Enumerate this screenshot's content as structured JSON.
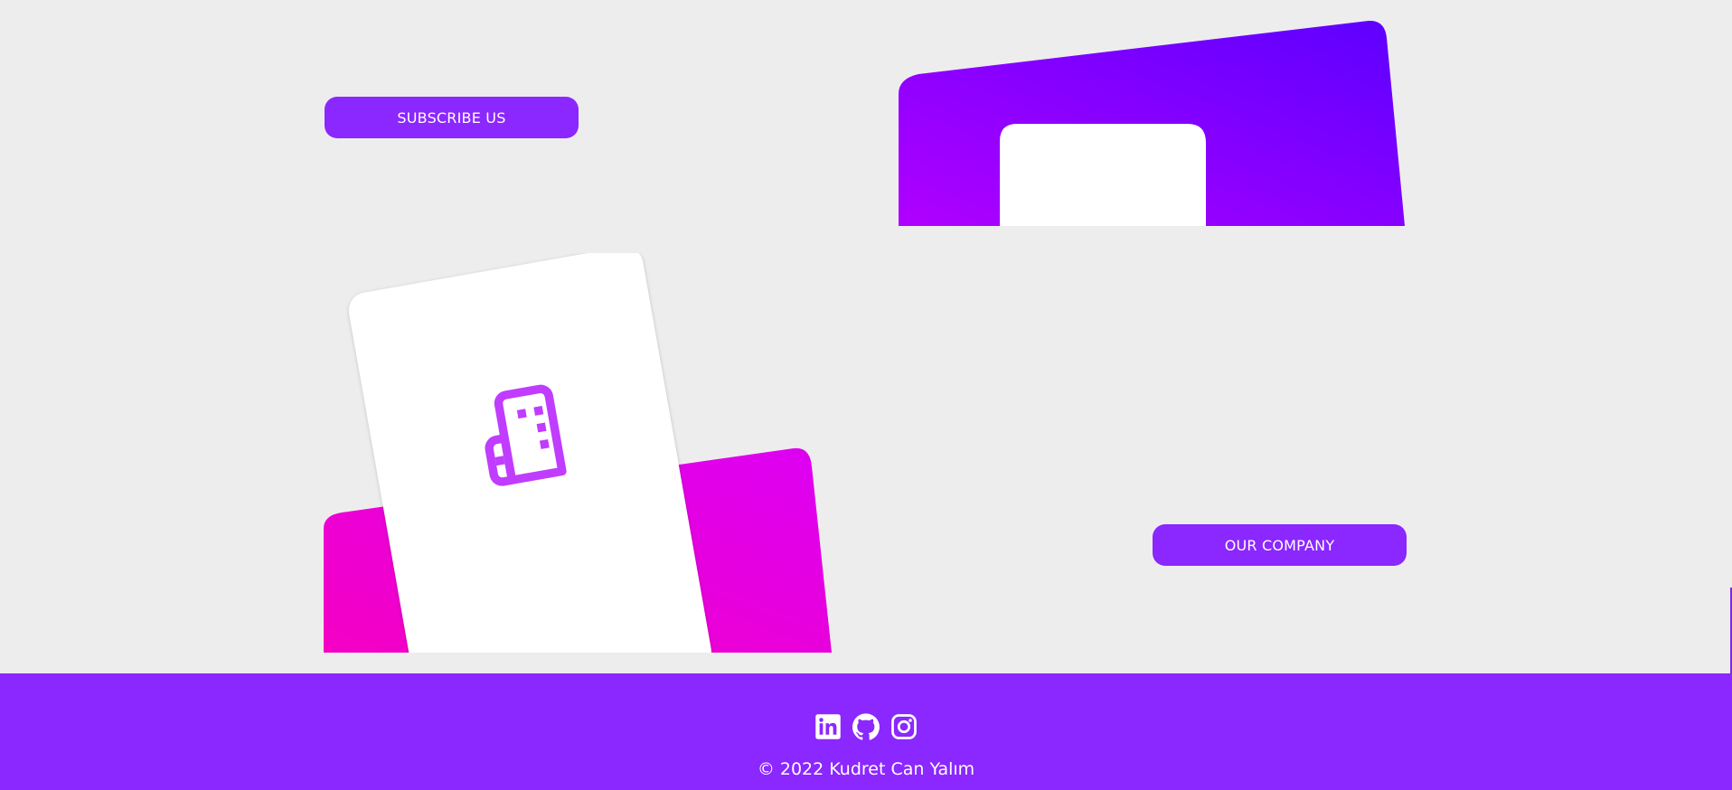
{
  "buttons": {
    "subscribe_label": "SUBSCRIBE US",
    "company_label": "OUR COMPANY"
  },
  "illustrations": {
    "top_card_icon": "blank-card",
    "bottom_card_icon": "building-icon"
  },
  "footer": {
    "social_links": [
      {
        "icon": "linkedin-icon"
      },
      {
        "icon": "github-icon"
      },
      {
        "icon": "instagram-icon"
      }
    ],
    "copyright": "© 2022 Kudret Can Yalım"
  },
  "colors": {
    "background": "#eeedee",
    "brand_purple": "#8b27ff",
    "gradient_purple_start": "#b000ff",
    "gradient_purple_end": "#5c00ff",
    "gradient_magenta_start": "#f500c4",
    "gradient_magenta_end": "#dc00f2",
    "icon_purple": "#c03cff",
    "white": "#ffffff"
  }
}
